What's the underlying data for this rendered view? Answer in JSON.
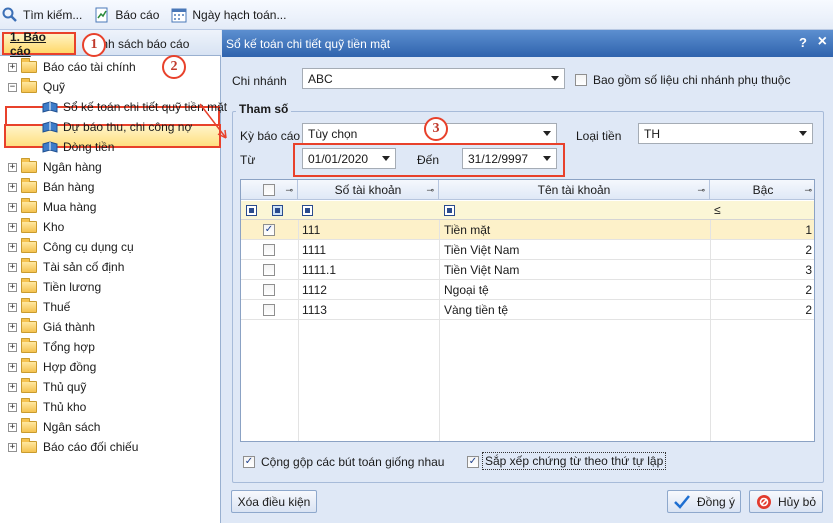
{
  "toolbar": {
    "search_label": "Tìm kiếm...",
    "report_label": "Báo cáo",
    "date_label": "Ngày hạch toán..."
  },
  "left": {
    "tab_reports": "1. Báo cáo",
    "tab_list": "Danh sách báo cáo",
    "tree": [
      {
        "label": "Báo cáo tài chính",
        "type": "folder",
        "expander": "+"
      },
      {
        "label": "Quỹ",
        "type": "folder",
        "expander": "−"
      },
      {
        "label": "Sổ kế toán chi tiết quỹ tiền mặt",
        "type": "report"
      },
      {
        "label": "Dự báo thu, chi công nợ",
        "type": "report"
      },
      {
        "label": "Dòng tiền",
        "type": "report"
      },
      {
        "label": "Ngân hàng",
        "type": "folder",
        "expander": "+"
      },
      {
        "label": "Bán hàng",
        "type": "folder",
        "expander": "+"
      },
      {
        "label": "Mua hàng",
        "type": "folder",
        "expander": "+"
      },
      {
        "label": "Kho",
        "type": "folder",
        "expander": "+"
      },
      {
        "label": "Công cụ dụng cụ",
        "type": "folder",
        "expander": "+"
      },
      {
        "label": "Tài sản cố định",
        "type": "folder",
        "expander": "+"
      },
      {
        "label": "Tiền lương",
        "type": "folder",
        "expander": "+"
      },
      {
        "label": "Thuế",
        "type": "folder",
        "expander": "+"
      },
      {
        "label": "Giá thành",
        "type": "folder",
        "expander": "+"
      },
      {
        "label": "Tổng hợp",
        "type": "folder",
        "expander": "+"
      },
      {
        "label": "Hợp đồng",
        "type": "folder",
        "expander": "+"
      },
      {
        "label": "Thủ quỹ",
        "type": "folder",
        "expander": "+"
      },
      {
        "label": "Thủ kho",
        "type": "folder",
        "expander": "+"
      },
      {
        "label": "Ngân sách",
        "type": "folder",
        "expander": "+"
      },
      {
        "label": "Báo cáo đối chiếu",
        "type": "folder",
        "expander": "+"
      }
    ]
  },
  "callouts": [
    "1",
    "2",
    "3"
  ],
  "dialog": {
    "title": "Sổ kế toán chi tiết quỹ tiền mặt",
    "help": "?",
    "close": "×",
    "branch_label": "Chi nhánh",
    "branch_value": "ABC",
    "include_sub_label": "Bao gồm số liệu chi nhánh phụ thuộc",
    "params_title": "Tham số",
    "period_label": "Kỳ báo cáo",
    "period_value": "Tùy chọn",
    "currency_label": "Loại tiền",
    "currency_value": "TH",
    "from_label": "Từ",
    "from_value": "01/01/2020",
    "to_label": "Đến",
    "to_value": "31/12/9997",
    "grid": {
      "headers": [
        "Số tài khoản",
        "Tên tài khoản",
        "Bậc"
      ],
      "filter_op": "≤",
      "rows": [
        {
          "checked": true,
          "account": "111",
          "name": "Tiền mặt",
          "level": "1"
        },
        {
          "checked": false,
          "account": "1111",
          "name": "Tiền Việt Nam",
          "level": "2"
        },
        {
          "checked": false,
          "account": "1111.1",
          "name": "Tiền Việt Nam",
          "level": "3"
        },
        {
          "checked": false,
          "account": "1112",
          "name": "Ngoại tệ",
          "level": "2"
        },
        {
          "checked": false,
          "account": "1113",
          "name": "Vàng tiền tệ",
          "level": "2"
        }
      ]
    },
    "merge_label": "Cộng gộp các bút toán giống nhau",
    "sort_label": "Sắp xếp chứng từ theo thứ tự lập",
    "clear_button": "Xóa điều kiện",
    "ok_button": "Đồng ý",
    "cancel_button": "Hủy bỏ"
  }
}
